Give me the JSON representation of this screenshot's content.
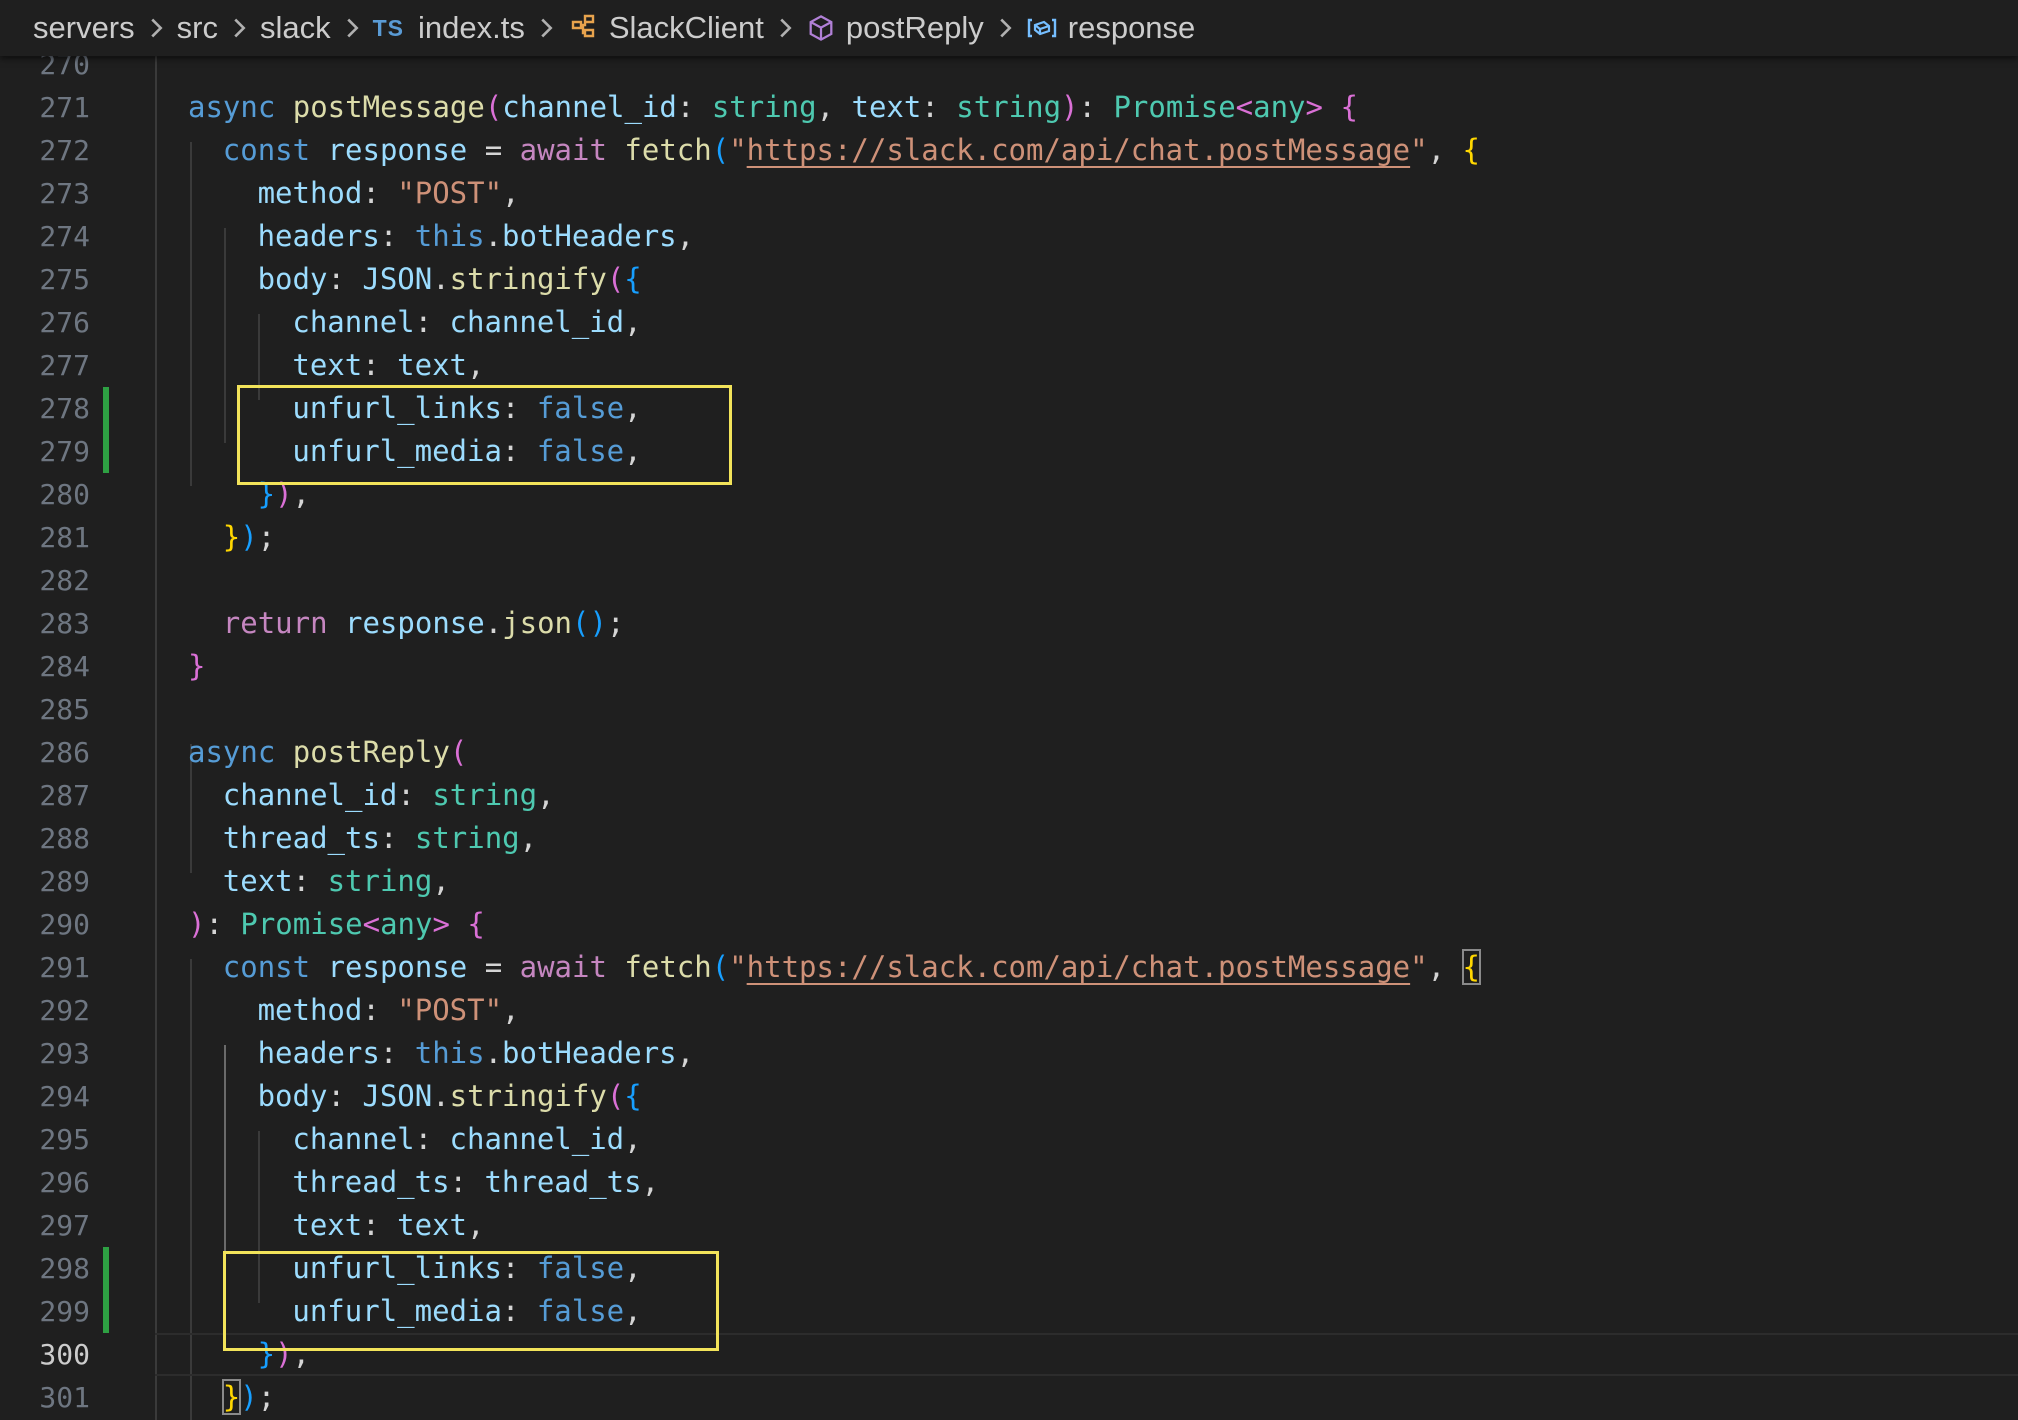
{
  "breadcrumb": {
    "items": [
      {
        "name": "crumb-servers",
        "label": "servers",
        "icon": null
      },
      {
        "name": "crumb-src",
        "label": "src",
        "icon": null
      },
      {
        "name": "crumb-slack",
        "label": "slack",
        "icon": null
      },
      {
        "name": "crumb-index-ts",
        "label": "index.ts",
        "icon": "typescript-file-icon",
        "badge": "TS"
      },
      {
        "name": "crumb-slackclient",
        "label": "SlackClient",
        "icon": "class-icon"
      },
      {
        "name": "crumb-postreply",
        "label": "postReply",
        "icon": "method-cube-icon"
      },
      {
        "name": "crumb-response",
        "label": "response",
        "icon": "variable-icon"
      }
    ]
  },
  "colors": {
    "highlight_box": "#f2e35a",
    "git_added": "#2ea043",
    "background": "#1f1f1f"
  },
  "editor": {
    "current_line": 300,
    "lines": [
      {
        "n": 270,
        "tokens": []
      },
      {
        "n": 271,
        "tokens": [
          [
            "k1",
            "async "
          ],
          [
            "fn",
            "postMessage"
          ],
          [
            "b2",
            "("
          ],
          [
            "v",
            "channel_id"
          ],
          [
            "p",
            ": "
          ],
          [
            "t",
            "string"
          ],
          [
            "p",
            ", "
          ],
          [
            "v",
            "text"
          ],
          [
            "p",
            ": "
          ],
          [
            "t",
            "string"
          ],
          [
            "b2",
            ")"
          ],
          [
            "p",
            ": "
          ],
          [
            "t",
            "Promise"
          ],
          [
            "b2",
            "<"
          ],
          [
            "t",
            "any"
          ],
          [
            "b2",
            ">"
          ],
          [
            "p",
            " "
          ],
          [
            "b2",
            "{"
          ]
        ]
      },
      {
        "n": 272,
        "tokens": [
          [
            "k1",
            "const "
          ],
          [
            "v",
            "response"
          ],
          [
            "p",
            " = "
          ],
          [
            "k2",
            "await "
          ],
          [
            "fn",
            "fetch"
          ],
          [
            "b3",
            "("
          ],
          [
            "s",
            "\""
          ],
          [
            "url",
            "https://slack.com/api/chat.postMessage"
          ],
          [
            "s",
            "\""
          ],
          [
            "p",
            ", "
          ],
          [
            "b1",
            "{"
          ]
        ]
      },
      {
        "n": 273,
        "tokens": [
          [
            "v",
            "method"
          ],
          [
            "p",
            ": "
          ],
          [
            "s",
            "\"POST\""
          ],
          [
            "p",
            ","
          ]
        ]
      },
      {
        "n": 274,
        "tokens": [
          [
            "v",
            "headers"
          ],
          [
            "p",
            ": "
          ],
          [
            "k1",
            "this"
          ],
          [
            "p",
            "."
          ],
          [
            "v",
            "botHeaders"
          ],
          [
            "p",
            ","
          ]
        ]
      },
      {
        "n": 275,
        "tokens": [
          [
            "v",
            "body"
          ],
          [
            "p",
            ": "
          ],
          [
            "v",
            "JSON"
          ],
          [
            "p",
            "."
          ],
          [
            "fn",
            "stringify"
          ],
          [
            "b2",
            "("
          ],
          [
            "b3",
            "{"
          ]
        ]
      },
      {
        "n": 276,
        "tokens": [
          [
            "v",
            "channel"
          ],
          [
            "p",
            ": "
          ],
          [
            "v",
            "channel_id"
          ],
          [
            "p",
            ","
          ]
        ]
      },
      {
        "n": 277,
        "tokens": [
          [
            "v",
            "text"
          ],
          [
            "p",
            ": "
          ],
          [
            "v",
            "text"
          ],
          [
            "p",
            ","
          ]
        ]
      },
      {
        "n": 278,
        "tokens": [
          [
            "v",
            "unfurl_links"
          ],
          [
            "p",
            ": "
          ],
          [
            "k1",
            "false"
          ],
          [
            "p",
            ","
          ]
        ],
        "git": "added"
      },
      {
        "n": 279,
        "tokens": [
          [
            "v",
            "unfurl_media"
          ],
          [
            "p",
            ": "
          ],
          [
            "k1",
            "false"
          ],
          [
            "p",
            ","
          ]
        ],
        "git": "added"
      },
      {
        "n": 280,
        "tokens": [
          [
            "b3",
            "}"
          ],
          [
            "b2",
            ")"
          ],
          [
            "p",
            ","
          ]
        ]
      },
      {
        "n": 281,
        "tokens": [
          [
            "b1",
            "}"
          ],
          [
            "b3",
            ")"
          ],
          [
            "p",
            ";"
          ]
        ]
      },
      {
        "n": 282,
        "tokens": []
      },
      {
        "n": 283,
        "tokens": [
          [
            "k2",
            "return "
          ],
          [
            "v",
            "response"
          ],
          [
            "p",
            "."
          ],
          [
            "fn",
            "json"
          ],
          [
            "b3",
            "()"
          ],
          [
            "p",
            ";"
          ]
        ]
      },
      {
        "n": 284,
        "tokens": [
          [
            "b2",
            "}"
          ]
        ]
      },
      {
        "n": 285,
        "tokens": []
      },
      {
        "n": 286,
        "tokens": [
          [
            "k1",
            "async "
          ],
          [
            "fn",
            "postReply"
          ],
          [
            "b2",
            "("
          ]
        ]
      },
      {
        "n": 287,
        "tokens": [
          [
            "v",
            "channel_id"
          ],
          [
            "p",
            ": "
          ],
          [
            "t",
            "string"
          ],
          [
            "p",
            ","
          ]
        ]
      },
      {
        "n": 288,
        "tokens": [
          [
            "v",
            "thread_ts"
          ],
          [
            "p",
            ": "
          ],
          [
            "t",
            "string"
          ],
          [
            "p",
            ","
          ]
        ]
      },
      {
        "n": 289,
        "tokens": [
          [
            "v",
            "text"
          ],
          [
            "p",
            ": "
          ],
          [
            "t",
            "string"
          ],
          [
            "p",
            ","
          ]
        ]
      },
      {
        "n": 290,
        "tokens": [
          [
            "b2",
            ")"
          ],
          [
            "p",
            ": "
          ],
          [
            "t",
            "Promise"
          ],
          [
            "b2",
            "<"
          ],
          [
            "t",
            "any"
          ],
          [
            "b2",
            ">"
          ],
          [
            "p",
            " "
          ],
          [
            "b2",
            "{"
          ]
        ]
      },
      {
        "n": 291,
        "tokens": [
          [
            "k1",
            "const "
          ],
          [
            "v",
            "response"
          ],
          [
            "p",
            " = "
          ],
          [
            "k2",
            "await "
          ],
          [
            "fn",
            "fetch"
          ],
          [
            "b3",
            "("
          ],
          [
            "s",
            "\""
          ],
          [
            "url",
            "https://slack.com/api/chat.postMessage"
          ],
          [
            "s",
            "\""
          ],
          [
            "p",
            ", "
          ],
          [
            "b1 bm",
            "{"
          ]
        ]
      },
      {
        "n": 292,
        "tokens": [
          [
            "v",
            "method"
          ],
          [
            "p",
            ": "
          ],
          [
            "s",
            "\"POST\""
          ],
          [
            "p",
            ","
          ]
        ]
      },
      {
        "n": 293,
        "tokens": [
          [
            "v",
            "headers"
          ],
          [
            "p",
            ": "
          ],
          [
            "k1",
            "this"
          ],
          [
            "p",
            "."
          ],
          [
            "v",
            "botHeaders"
          ],
          [
            "p",
            ","
          ]
        ]
      },
      {
        "n": 294,
        "tokens": [
          [
            "v",
            "body"
          ],
          [
            "p",
            ": "
          ],
          [
            "v",
            "JSON"
          ],
          [
            "p",
            "."
          ],
          [
            "fn",
            "stringify"
          ],
          [
            "b2",
            "("
          ],
          [
            "b3",
            "{"
          ]
        ]
      },
      {
        "n": 295,
        "tokens": [
          [
            "v",
            "channel"
          ],
          [
            "p",
            ": "
          ],
          [
            "v",
            "channel_id"
          ],
          [
            "p",
            ","
          ]
        ]
      },
      {
        "n": 296,
        "tokens": [
          [
            "v",
            "thread_ts"
          ],
          [
            "p",
            ": "
          ],
          [
            "v",
            "thread_ts"
          ],
          [
            "p",
            ","
          ]
        ]
      },
      {
        "n": 297,
        "tokens": [
          [
            "v",
            "text"
          ],
          [
            "p",
            ": "
          ],
          [
            "v",
            "text"
          ],
          [
            "p",
            ","
          ]
        ]
      },
      {
        "n": 298,
        "tokens": [
          [
            "v",
            "unfurl_links"
          ],
          [
            "p",
            ": "
          ],
          [
            "k1",
            "false"
          ],
          [
            "p",
            ","
          ]
        ],
        "git": "added"
      },
      {
        "n": 299,
        "tokens": [
          [
            "v",
            "unfurl_media"
          ],
          [
            "p",
            ": "
          ],
          [
            "k1",
            "false"
          ],
          [
            "p",
            ","
          ]
        ],
        "git": "added"
      },
      {
        "n": 300,
        "tokens": [
          [
            "b3",
            "}"
          ],
          [
            "b2",
            ")"
          ],
          [
            "p",
            ","
          ]
        ]
      },
      {
        "n": 301,
        "tokens": [
          [
            "b1 bm",
            "}"
          ],
          [
            "b3",
            ")"
          ],
          [
            "p",
            ";"
          ]
        ]
      }
    ]
  }
}
